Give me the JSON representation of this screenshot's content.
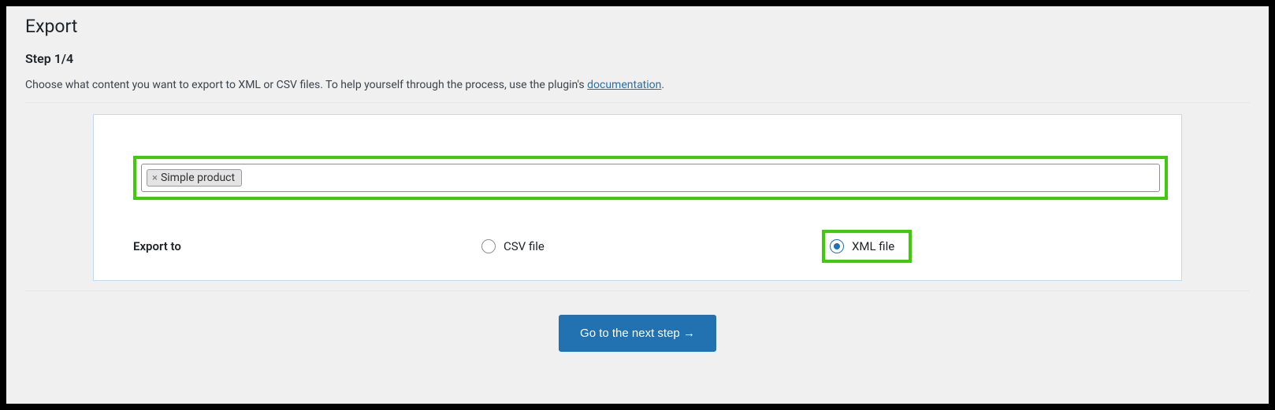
{
  "header": {
    "title": "Export",
    "step": "Step 1/4",
    "description_pre": "Choose what content you want to export to XML or CSV files. To help yourself through the process, use the plugin's ",
    "description_link": "documentation",
    "description_post": "."
  },
  "content_select": {
    "chip_label": "Simple product",
    "chip_remove_glyph": "×"
  },
  "export_to": {
    "label": "Export to",
    "csv_label": "CSV file",
    "xml_label": "XML file"
  },
  "actions": {
    "next_button": "Go to the next step →"
  }
}
